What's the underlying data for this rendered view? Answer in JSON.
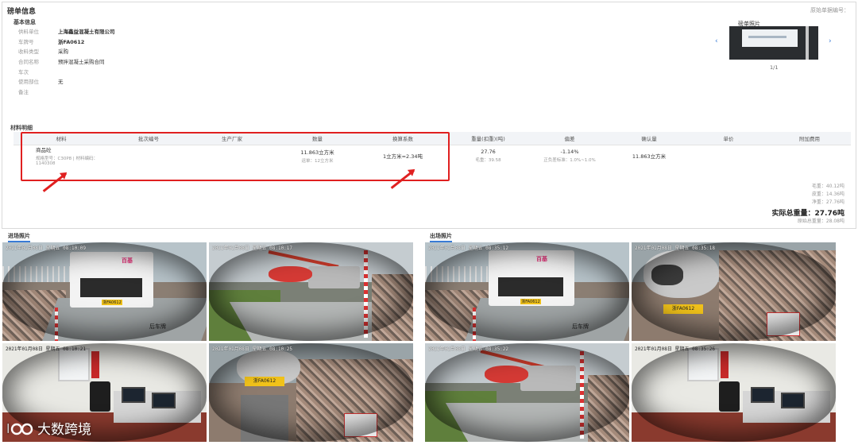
{
  "panel": {
    "title": "磅单信息",
    "right_note": "原始单据编号："
  },
  "basic": {
    "section_title": "基本信息",
    "rows": [
      {
        "key": "供料单位",
        "value": "上海鑫益混凝土有限公司"
      },
      {
        "key": "车牌号",
        "value": "浙FA0612"
      },
      {
        "key": "收料类型",
        "value": "采购"
      },
      {
        "key": "合同名称",
        "value": "预拌混凝土采购合同"
      },
      {
        "key": "车次",
        "value": ""
      },
      {
        "key": "使用部位",
        "value": "无"
      },
      {
        "key": "备注",
        "value": ""
      }
    ]
  },
  "photo": {
    "title": "磅单照片",
    "pager": "1/1",
    "prev": "‹",
    "next": "›"
  },
  "materials": {
    "section_title": "材料明细",
    "headers": [
      "材料",
      "批次编号",
      "生产厂家",
      "数量",
      "换算系数",
      "重量(扣重)(吨)",
      "偏差",
      "确认量",
      "单价",
      "附加费用"
    ],
    "row": {
      "material": "商品砼",
      "material_spec": "规格型号：C30P8 | 材料编码：1140308",
      "batch": "",
      "manufacturer": "",
      "quantity": "11.863立方米",
      "quantity_sub": "运单：12立方米",
      "factor": "1立方米=2.34吨",
      "weight": "27.76",
      "weight_sub": "毛重：39.58",
      "deviation": "-1.14%",
      "deviation_sub": "正负差标准：1.0%~1.0%",
      "confirmed": "11.863立方米",
      "price": "",
      "extra": ""
    }
  },
  "summary": {
    "lines": [
      "毛重：40.12吨",
      "皮重：14.36吨",
      "净重：27.76吨"
    ],
    "total": "实际总重量：27.76吨",
    "bottom": "原始总重量：28.08吨"
  },
  "entry": {
    "title": "进场照片",
    "cams": [
      {
        "ts": "2021年01月08日  星期五  08:10:09",
        "label": "后车牌"
      },
      {
        "ts": "2021年01月08日  星期五  08:10:17",
        "label": ""
      },
      {
        "ts": "2021年01月08日  星期五  08:10:21",
        "label": ""
      },
      {
        "ts": "2021年01月08日  星期五  08:10:25",
        "label": ""
      }
    ]
  },
  "exit": {
    "title": "出场照片",
    "cams": [
      {
        "ts": "2021年01月08日  星期五  08:35:12",
        "label": "后车牌"
      },
      {
        "ts": "2021年01月08日  星期五  08:35:18",
        "label": ""
      },
      {
        "ts": "2021年01月08日  星期五  08:35:22",
        "label": ""
      },
      {
        "ts": "2021年01月08日  星期五  08:35:26",
        "label": ""
      }
    ]
  },
  "truck_text": "百基",
  "plate_text": "浙FA0612",
  "watermark": {
    "text": "大数跨境"
  }
}
